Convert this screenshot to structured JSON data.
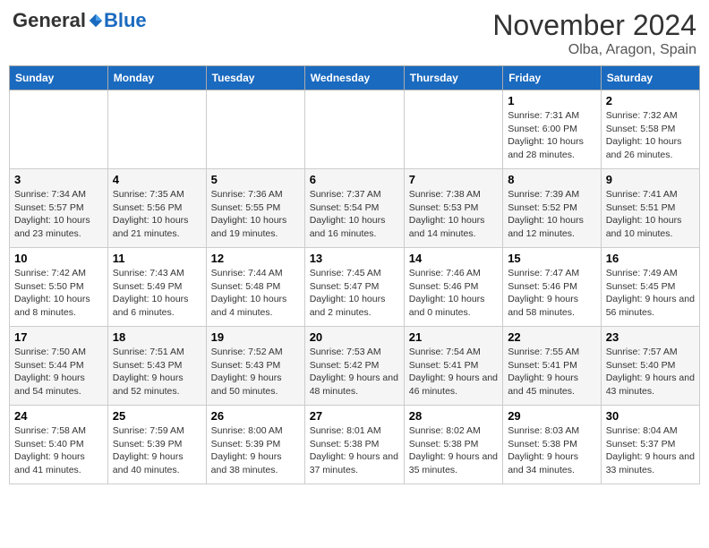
{
  "header": {
    "logo": {
      "general": "General",
      "blue": "Blue"
    },
    "title": "November 2024",
    "location": "Olba, Aragon, Spain"
  },
  "days_of_week": [
    "Sunday",
    "Monday",
    "Tuesday",
    "Wednesday",
    "Thursday",
    "Friday",
    "Saturday"
  ],
  "weeks": [
    [
      null,
      null,
      null,
      null,
      null,
      {
        "day": "1",
        "sunrise": "Sunrise: 7:31 AM",
        "sunset": "Sunset: 6:00 PM",
        "daylight": "Daylight: 10 hours and 28 minutes."
      },
      {
        "day": "2",
        "sunrise": "Sunrise: 7:32 AM",
        "sunset": "Sunset: 5:58 PM",
        "daylight": "Daylight: 10 hours and 26 minutes."
      }
    ],
    [
      {
        "day": "3",
        "sunrise": "Sunrise: 7:34 AM",
        "sunset": "Sunset: 5:57 PM",
        "daylight": "Daylight: 10 hours and 23 minutes."
      },
      {
        "day": "4",
        "sunrise": "Sunrise: 7:35 AM",
        "sunset": "Sunset: 5:56 PM",
        "daylight": "Daylight: 10 hours and 21 minutes."
      },
      {
        "day": "5",
        "sunrise": "Sunrise: 7:36 AM",
        "sunset": "Sunset: 5:55 PM",
        "daylight": "Daylight: 10 hours and 19 minutes."
      },
      {
        "day": "6",
        "sunrise": "Sunrise: 7:37 AM",
        "sunset": "Sunset: 5:54 PM",
        "daylight": "Daylight: 10 hours and 16 minutes."
      },
      {
        "day": "7",
        "sunrise": "Sunrise: 7:38 AM",
        "sunset": "Sunset: 5:53 PM",
        "daylight": "Daylight: 10 hours and 14 minutes."
      },
      {
        "day": "8",
        "sunrise": "Sunrise: 7:39 AM",
        "sunset": "Sunset: 5:52 PM",
        "daylight": "Daylight: 10 hours and 12 minutes."
      },
      {
        "day": "9",
        "sunrise": "Sunrise: 7:41 AM",
        "sunset": "Sunset: 5:51 PM",
        "daylight": "Daylight: 10 hours and 10 minutes."
      }
    ],
    [
      {
        "day": "10",
        "sunrise": "Sunrise: 7:42 AM",
        "sunset": "Sunset: 5:50 PM",
        "daylight": "Daylight: 10 hours and 8 minutes."
      },
      {
        "day": "11",
        "sunrise": "Sunrise: 7:43 AM",
        "sunset": "Sunset: 5:49 PM",
        "daylight": "Daylight: 10 hours and 6 minutes."
      },
      {
        "day": "12",
        "sunrise": "Sunrise: 7:44 AM",
        "sunset": "Sunset: 5:48 PM",
        "daylight": "Daylight: 10 hours and 4 minutes."
      },
      {
        "day": "13",
        "sunrise": "Sunrise: 7:45 AM",
        "sunset": "Sunset: 5:47 PM",
        "daylight": "Daylight: 10 hours and 2 minutes."
      },
      {
        "day": "14",
        "sunrise": "Sunrise: 7:46 AM",
        "sunset": "Sunset: 5:46 PM",
        "daylight": "Daylight: 10 hours and 0 minutes."
      },
      {
        "day": "15",
        "sunrise": "Sunrise: 7:47 AM",
        "sunset": "Sunset: 5:46 PM",
        "daylight": "Daylight: 9 hours and 58 minutes."
      },
      {
        "day": "16",
        "sunrise": "Sunrise: 7:49 AM",
        "sunset": "Sunset: 5:45 PM",
        "daylight": "Daylight: 9 hours and 56 minutes."
      }
    ],
    [
      {
        "day": "17",
        "sunrise": "Sunrise: 7:50 AM",
        "sunset": "Sunset: 5:44 PM",
        "daylight": "Daylight: 9 hours and 54 minutes."
      },
      {
        "day": "18",
        "sunrise": "Sunrise: 7:51 AM",
        "sunset": "Sunset: 5:43 PM",
        "daylight": "Daylight: 9 hours and 52 minutes."
      },
      {
        "day": "19",
        "sunrise": "Sunrise: 7:52 AM",
        "sunset": "Sunset: 5:43 PM",
        "daylight": "Daylight: 9 hours and 50 minutes."
      },
      {
        "day": "20",
        "sunrise": "Sunrise: 7:53 AM",
        "sunset": "Sunset: 5:42 PM",
        "daylight": "Daylight: 9 hours and 48 minutes."
      },
      {
        "day": "21",
        "sunrise": "Sunrise: 7:54 AM",
        "sunset": "Sunset: 5:41 PM",
        "daylight": "Daylight: 9 hours and 46 minutes."
      },
      {
        "day": "22",
        "sunrise": "Sunrise: 7:55 AM",
        "sunset": "Sunset: 5:41 PM",
        "daylight": "Daylight: 9 hours and 45 minutes."
      },
      {
        "day": "23",
        "sunrise": "Sunrise: 7:57 AM",
        "sunset": "Sunset: 5:40 PM",
        "daylight": "Daylight: 9 hours and 43 minutes."
      }
    ],
    [
      {
        "day": "24",
        "sunrise": "Sunrise: 7:58 AM",
        "sunset": "Sunset: 5:40 PM",
        "daylight": "Daylight: 9 hours and 41 minutes."
      },
      {
        "day": "25",
        "sunrise": "Sunrise: 7:59 AM",
        "sunset": "Sunset: 5:39 PM",
        "daylight": "Daylight: 9 hours and 40 minutes."
      },
      {
        "day": "26",
        "sunrise": "Sunrise: 8:00 AM",
        "sunset": "Sunset: 5:39 PM",
        "daylight": "Daylight: 9 hours and 38 minutes."
      },
      {
        "day": "27",
        "sunrise": "Sunrise: 8:01 AM",
        "sunset": "Sunset: 5:38 PM",
        "daylight": "Daylight: 9 hours and 37 minutes."
      },
      {
        "day": "28",
        "sunrise": "Sunrise: 8:02 AM",
        "sunset": "Sunset: 5:38 PM",
        "daylight": "Daylight: 9 hours and 35 minutes."
      },
      {
        "day": "29",
        "sunrise": "Sunrise: 8:03 AM",
        "sunset": "Sunset: 5:38 PM",
        "daylight": "Daylight: 9 hours and 34 minutes."
      },
      {
        "day": "30",
        "sunrise": "Sunrise: 8:04 AM",
        "sunset": "Sunset: 5:37 PM",
        "daylight": "Daylight: 9 hours and 33 minutes."
      }
    ]
  ]
}
